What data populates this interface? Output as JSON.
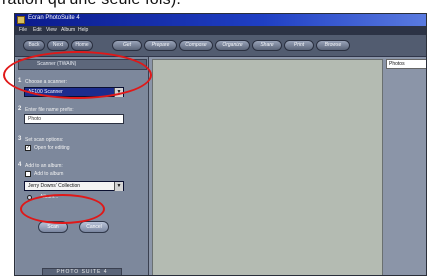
{
  "caption": {
    "text": "ration qu'une seule fois)."
  },
  "window": {
    "title": "Ecran PhotoSuite 4",
    "menu": [
      "File",
      "Edit",
      "View",
      "Album",
      "Help"
    ]
  },
  "toolbar": {
    "nav": [
      "Back",
      "Next",
      "Home"
    ],
    "buttons": [
      "Get",
      "Prepare",
      "Compose",
      "Organize",
      "Share",
      "Print",
      "Browse"
    ]
  },
  "sidepanel": {
    "tab_label": "Scanner (TWAIN)",
    "step1": {
      "num": "1",
      "label": "Choose a scanner:",
      "value": "AF100 Scanner"
    },
    "step2": {
      "num": "2",
      "label": "Enter file name prefix:",
      "value": "Photo"
    },
    "step3": {
      "num": "3",
      "label": "Set scan options:",
      "option": "Open for editing",
      "checked": true
    },
    "step4": {
      "num": "4",
      "label": "Add to an album:",
      "option": "Add to album",
      "checked": false,
      "album_value": "Jerry Downs' Collection",
      "album_button": "Album..."
    },
    "buttons": {
      "scan": "Scan",
      "cancel": "Cancel"
    },
    "brand": "PHOTO SUITE 4"
  },
  "rightpanel": {
    "tab": "Photos"
  },
  "colors": {
    "highlight_ring": "#e01818",
    "title_bar": "#0a1a8c"
  }
}
